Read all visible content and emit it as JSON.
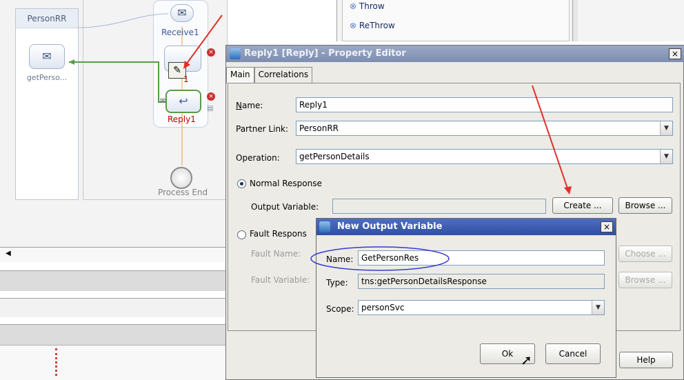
{
  "canvas": {
    "partner_title": "PersonRR",
    "partner_node_label": "getPerso...",
    "receive_label": "Receive1",
    "reply_label": "Reply1",
    "hidden_label_fragment": "1",
    "process_end_label": "Process End"
  },
  "palette": {
    "items": [
      {
        "label": "Throw"
      },
      {
        "label": "ReThrow"
      }
    ]
  },
  "property_editor": {
    "title": "Reply1 [Reply] - Property Editor",
    "close_glyph": "×",
    "tabs": [
      {
        "label": "Main",
        "active": true
      },
      {
        "label": "Correlations",
        "active": false
      }
    ],
    "name_label": "Name:",
    "name_value": "Reply1",
    "partner_link_label": "Partner Link:",
    "partner_link_value": "PersonRR",
    "operation_label": "Operation:",
    "operation_value": "getPersonDetails",
    "normal_response_label": "Normal Response",
    "normal_response_selected": true,
    "output_variable_label": "Output Variable:",
    "output_variable_value": "",
    "create_button": "Create ...",
    "browse_button": "Browse ...",
    "fault_response_label": "Fault Respons",
    "fault_name_label": "Fault Name:",
    "choose_button": "Choose ...",
    "fault_variable_label": "Fault Variable:",
    "browse_button_2": "Browse ...",
    "help_button": "Help"
  },
  "new_output_variable": {
    "title": "New Output Variable",
    "close_glyph": "×",
    "name_label": "Name:",
    "name_value": "GetPersonRes",
    "type_label": "Type:",
    "type_value": "tns:getPersonDetailsResponse",
    "scope_label": "Scope:",
    "scope_value": "personSvc",
    "ok_button": "Ok",
    "cancel_button": "Cancel"
  },
  "colors": {
    "annotation_arrow": "#e0302a",
    "highlight_ellipse": "#3a3ad0",
    "reply_label": "#c00000",
    "link_green": "#5a9a4a"
  }
}
